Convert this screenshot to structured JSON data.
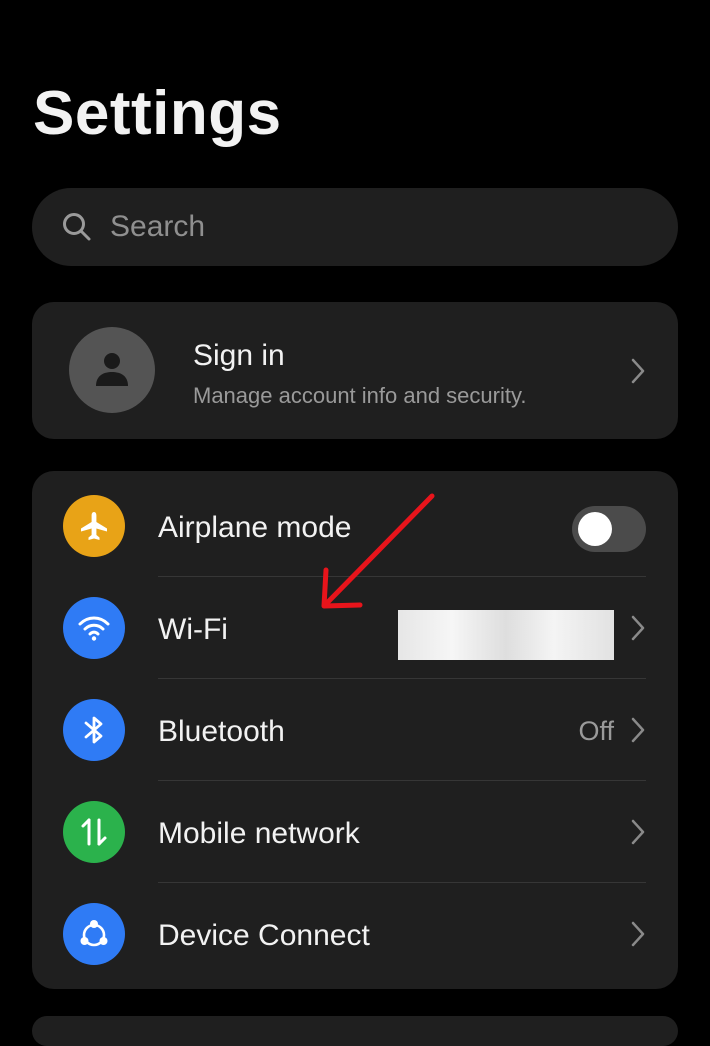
{
  "header": {
    "title": "Settings"
  },
  "search": {
    "placeholder": "Search",
    "icon": "search-icon"
  },
  "account": {
    "title": "Sign in",
    "subtitle": "Manage account info and security.",
    "avatar_icon": "person-icon"
  },
  "network": {
    "items": [
      {
        "label": "Airplane mode",
        "icon": "airplane-icon",
        "icon_color": "#E8A317",
        "control": "toggle",
        "toggle_on": false
      },
      {
        "label": "Wi-Fi",
        "icon": "wifi-icon",
        "icon_color": "#2F7BF5",
        "control": "chevron",
        "value_redacted": true
      },
      {
        "label": "Bluetooth",
        "icon": "bluetooth-icon",
        "icon_color": "#2F7BF5",
        "control": "chevron",
        "value": "Off"
      },
      {
        "label": "Mobile network",
        "icon": "mobile-data-icon",
        "icon_color": "#2BB24C",
        "control": "chevron"
      },
      {
        "label": "Device Connect",
        "icon": "device-connect-icon",
        "icon_color": "#2F7BF5",
        "control": "chevron"
      }
    ]
  },
  "colors": {
    "background": "#000000",
    "card": "#1F1F1F",
    "annotation_arrow": "#E8141B"
  }
}
